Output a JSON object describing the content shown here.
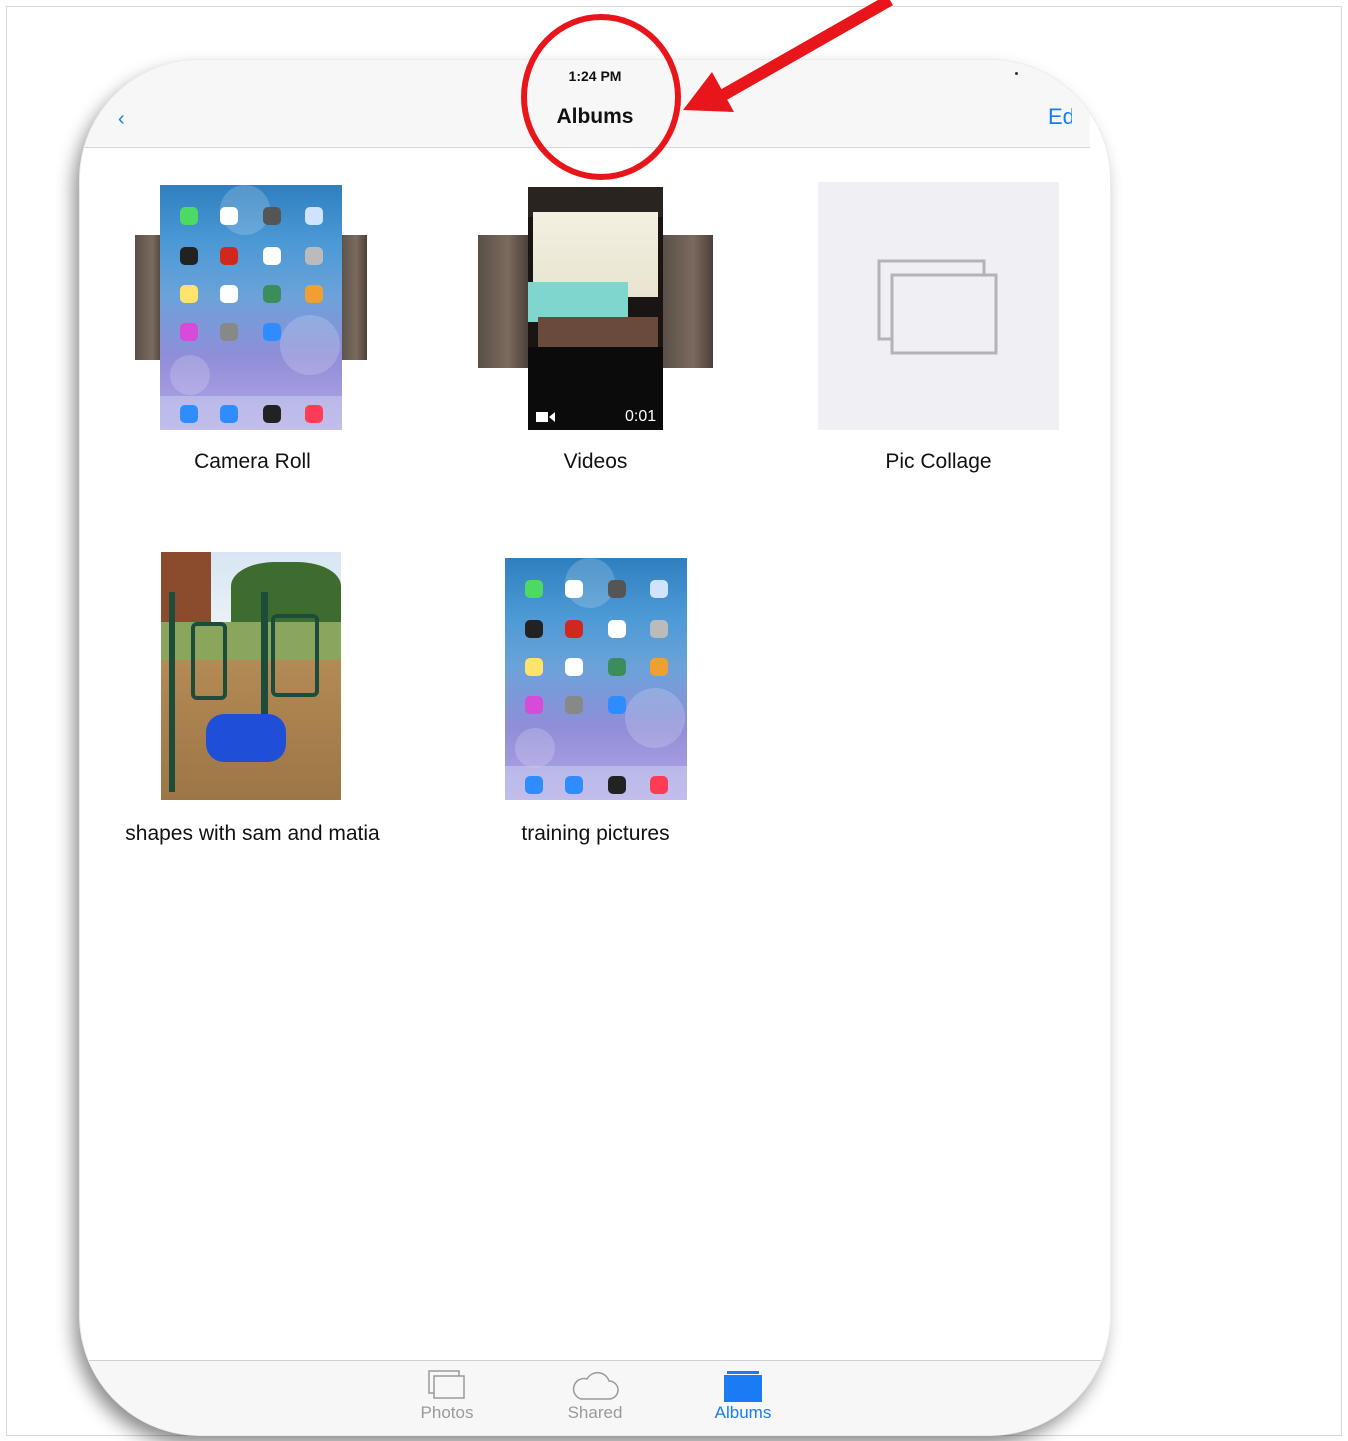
{
  "status_bar": {
    "time": "1:24 PM"
  },
  "nav": {
    "title": "Albums",
    "left_button": "‹",
    "right_button": "Edit"
  },
  "albums": [
    {
      "name": "Camera Roll"
    },
    {
      "name": "Videos",
      "duration": "0:01"
    },
    {
      "name": "Pic Collage"
    },
    {
      "name": "shapes with sam and matia"
    },
    {
      "name": "training pictures"
    }
  ],
  "tab_bar": {
    "tabs": [
      {
        "label": "Photos",
        "icon": "photos-icon",
        "selected": false
      },
      {
        "label": "Shared",
        "icon": "cloud-icon",
        "selected": false
      },
      {
        "label": "Albums",
        "icon": "albums-icon",
        "selected": true
      }
    ]
  },
  "colors": {
    "accent": "#1a7cf5",
    "annotation": "#e8161b",
    "tab_inactive": "#9a9a9a"
  }
}
